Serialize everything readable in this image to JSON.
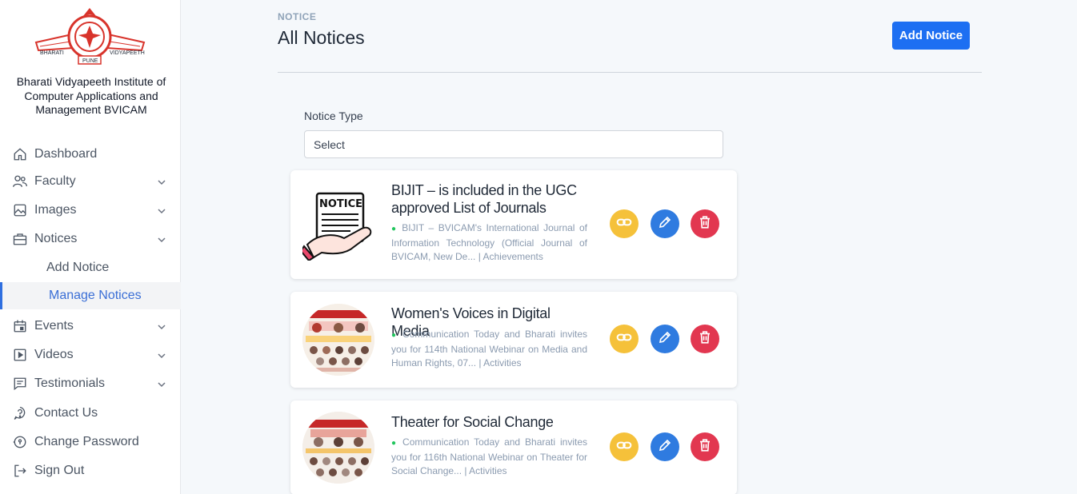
{
  "brand": {
    "logo_text_left": "BHARATI",
    "logo_text_right": "VIDYAPEETH",
    "logo_text_bottom": "PUNE",
    "org_name": "Bharati Vidyapeeth Institute of Computer Applications and Management BVICAM"
  },
  "sidebar": {
    "items": [
      {
        "label": "Dashboard",
        "icon": "home-icon"
      },
      {
        "label": "Faculty",
        "icon": "users-icon"
      },
      {
        "label": "Images",
        "icon": "image-icon"
      },
      {
        "label": "Notices",
        "icon": "briefcase-icon"
      },
      {
        "label": "Add Notice"
      },
      {
        "label": "Manage Notices"
      },
      {
        "label": "Events",
        "icon": "calendar-icon"
      },
      {
        "label": "Videos",
        "icon": "video-icon"
      },
      {
        "label": "Testimonials",
        "icon": "message-icon"
      },
      {
        "label": "Contact Us",
        "icon": "help-icon"
      },
      {
        "label": "Change Password",
        "icon": "key-icon"
      },
      {
        "label": "Sign Out",
        "icon": "sign-out-icon"
      }
    ]
  },
  "header": {
    "section": "NOTICE",
    "title": "All Notices",
    "add_button": "Add Notice"
  },
  "filter": {
    "label": "Notice Type",
    "selected": "Select"
  },
  "notices": [
    {
      "title": "BIJIT – is included in the UGC approved List of Journals",
      "description": "BIJIT – BVICAM's International Journal of Information Technology (Official Journal of BVICAM, New De... | Achievements",
      "thumb_text": "NOTICE"
    },
    {
      "title": "Women's Voices in Digital Media",
      "description": "Communication Today and Bharati invites you for 114th National Webinar on Media and Human Rights, 07... | Activities"
    },
    {
      "title": "Theater for Social Change",
      "description": "Communication Today and Bharati invites you for 116th National Webinar on Theater for Social Change... | Activities"
    }
  ],
  "colors": {
    "primary": "#1d6ff2",
    "link_action": "#f5c13a",
    "edit_action": "#2f7be0",
    "delete_action": "#e23750",
    "active_nav": "#3b6fd6"
  }
}
